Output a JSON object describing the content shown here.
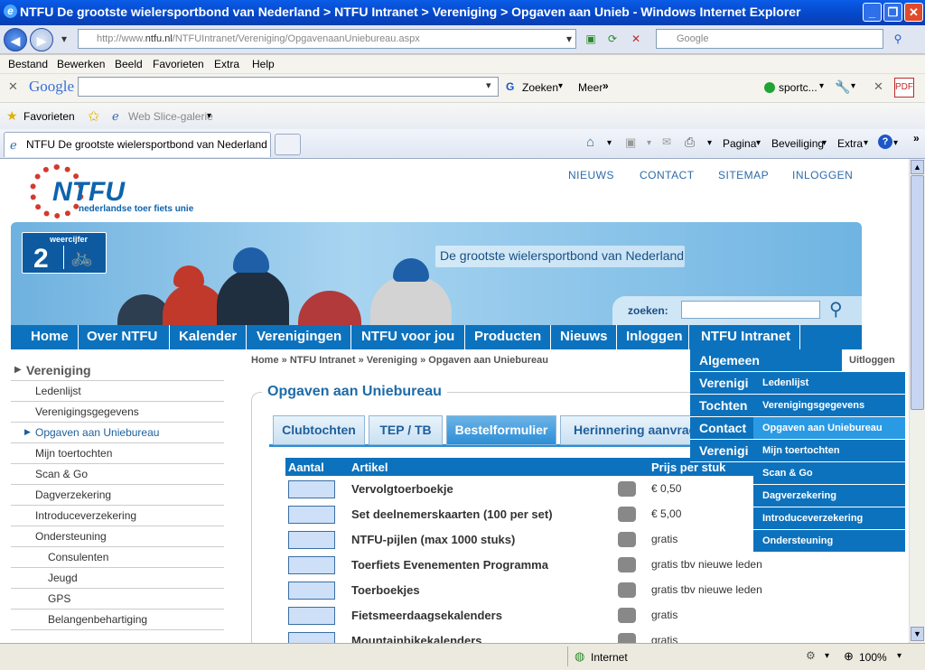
{
  "window": {
    "title": "NTFU De grootste wielersportbond van Nederland > NTFU Intranet > Vereniging > Opgaven aan Unieb - Windows Internet Explorer"
  },
  "browser": {
    "url_prefix": "http://www.",
    "url_domain": "ntfu.nl",
    "url_rest": "/NTFUIntranet/Vereniging/OpgavenaanUniebureau.aspx",
    "search_placeholder": "Google",
    "menu": [
      "Bestand",
      "Bewerken",
      "Beeld",
      "Favorieten",
      "Extra",
      "Help"
    ],
    "google_bar": {
      "logo": "Google",
      "zoeken": "Zoeken",
      "meer": "Meer",
      "sportc": "sportc..."
    },
    "favorites": {
      "label": "Favorieten",
      "web_slice": "Web Slice-galerie"
    },
    "tab_title": "NTFU De grootste wielersportbond van Nederland > ...",
    "cmd": {
      "pagina": "Pagina",
      "beveiliging": "Beveiliging",
      "extra": "Extra"
    },
    "status": {
      "zone": "Internet",
      "zoom": "100%"
    }
  },
  "site": {
    "logo_text": "NTFU",
    "logo_sub": "nederlandse toer fiets unie",
    "top_links": [
      "NIEUWS",
      "CONTACT",
      "SITEMAP",
      "INLOGGEN"
    ],
    "banner": {
      "badge_label": "weercijfer",
      "badge_value": "2",
      "slogan": "De grootste wielersportbond van Nederland",
      "search_label": "zoeken:"
    },
    "nav": [
      "Home",
      "Over NTFU",
      "Kalender",
      "Verenigingen",
      "NTFU voor jou",
      "Producten",
      "Nieuws",
      "Inloggen",
      "NTFU Intranet"
    ],
    "breadcrumb": [
      "Home",
      "NTFU Intranet",
      "Vereniging",
      "Opgaven aan Uniebureau"
    ],
    "breadcrumb_sep": "»",
    "logout": "Uitloggen",
    "sidebar": {
      "heading": "Vereniging",
      "items": [
        "Ledenlijst",
        "Verenigingsgegevens",
        "Opgaven aan Uniebureau",
        "Mijn toertochten",
        "Scan & Go",
        "Dagverzekering",
        "Introduceverzekering",
        "Ondersteuning"
      ],
      "subitems": [
        "Consulenten",
        "Jeugd",
        "GPS",
        "Belangenbehartiging"
      ]
    },
    "page_title": "Opgaven aan Uniebureau",
    "tabs": [
      "Clubtochten",
      "TEP / TB",
      "Bestelformulier",
      "Herinnering aanvrag"
    ],
    "table": {
      "headers": [
        "Aantal",
        "Artikel",
        "Prijs per stuk"
      ],
      "rows": [
        {
          "name": "Vervolgtoerboekje",
          "price": "€ 0,50"
        },
        {
          "name": "Set deelnemerskaarten (100 per set)",
          "price": "€ 5,00"
        },
        {
          "name": "NTFU-pijlen (max 1000 stuks)",
          "price": "gratis"
        },
        {
          "name": "Toerfiets Evenementen Programma",
          "price": "gratis tbv nieuwe leden"
        },
        {
          "name": "Toerboekjes",
          "price": "gratis tbv nieuwe leden"
        },
        {
          "name": "Fietsmeerdaagsekalenders",
          "price": "gratis"
        },
        {
          "name": "Mountainbikekalenders",
          "price": "gratis"
        }
      ]
    },
    "dropdown1": [
      "Algemeen",
      "Verenigi",
      "Tochten",
      "Contact",
      "Verenigi"
    ],
    "dropdown2": [
      "Ledenlijst",
      "Verenigingsgegevens",
      "Opgaven aan Uniebureau",
      "Mijn toertochten",
      "Scan & Go",
      "Dagverzekering",
      "Introduceverzekering",
      "Ondersteuning"
    ]
  },
  "colors": {
    "brand_blue": "#0d72bd",
    "highlight": "#2a9ae5"
  }
}
